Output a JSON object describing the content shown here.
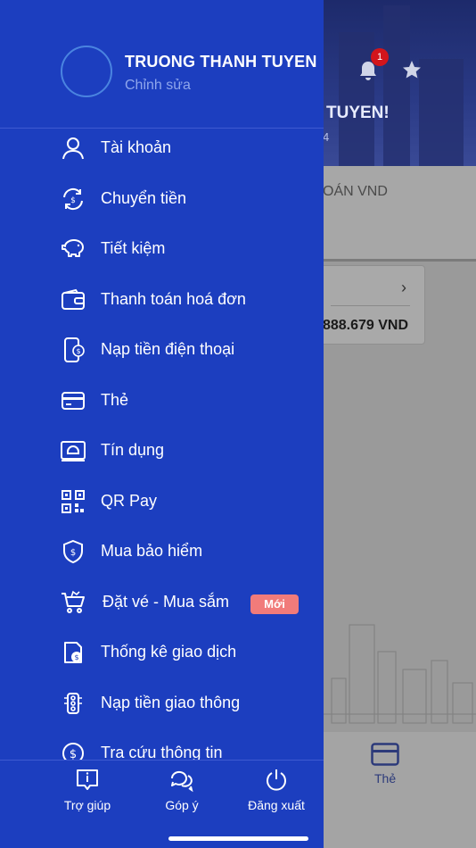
{
  "background": {
    "greeting": "TUYEN!",
    "greeting_sub": "4",
    "notification_count": "1",
    "tab_label": "OÁN VND",
    "balance": "888.679 VND",
    "bottom_tab_label": "Thẻ"
  },
  "profile": {
    "name": "TRUONG THANH TUYEN",
    "edit_label": "Chỉnh sửa"
  },
  "menu": [
    {
      "label": "Tài khoản",
      "icon": "user-icon"
    },
    {
      "label": "Chuyển tiền",
      "icon": "transfer-icon"
    },
    {
      "label": "Tiết kiệm",
      "icon": "piggy-bank-icon"
    },
    {
      "label": "Thanh toán hoá đơn",
      "icon": "wallet-icon"
    },
    {
      "label": "Nạp tiền điện thoại",
      "icon": "phone-topup-icon"
    },
    {
      "label": "Thẻ",
      "icon": "card-icon"
    },
    {
      "label": "Tín dụng",
      "icon": "credit-icon"
    },
    {
      "label": "QR Pay",
      "icon": "qr-icon"
    },
    {
      "label": "Mua bảo hiểm",
      "icon": "shield-icon"
    },
    {
      "label": "Đặt vé - Mua sắm",
      "icon": "cart-icon",
      "badge": "Mới"
    },
    {
      "label": "Thống kê giao dịch",
      "icon": "statement-icon"
    },
    {
      "label": "Nạp tiền giao thông",
      "icon": "traffic-icon"
    },
    {
      "label": "Tra cứu thông tin",
      "icon": "lookup-icon"
    }
  ],
  "footer": {
    "help_label": "Trợ giúp",
    "feedback_label": "Góp ý",
    "logout_label": "Đăng xuất"
  },
  "colors": {
    "drawer_bg": "#1c3ebf",
    "badge_bg": "#f17b7a",
    "notification_badge": "#d2151b"
  }
}
